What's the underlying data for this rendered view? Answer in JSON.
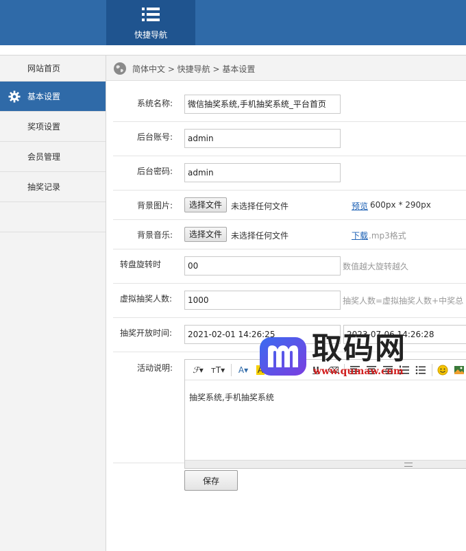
{
  "header": {
    "nav_label": "快捷导航",
    "nav_icon": "list-icon"
  },
  "sidebar": {
    "items": [
      {
        "label": "网站首页"
      },
      {
        "label": "基本设置",
        "icon": "gear-icon",
        "active": true
      },
      {
        "label": "奖项设置"
      },
      {
        "label": "会员管理"
      },
      {
        "label": "抽奖记录"
      }
    ]
  },
  "breadcrumb": {
    "text": "简体中文 > 快捷导航 > 基本设置",
    "icon": "globe-icon"
  },
  "form": {
    "system_name": {
      "label": "系统名称:",
      "value": "微信抽奖系统,手机抽奖系统_平台首页"
    },
    "admin_account": {
      "label": "后台账号:",
      "value": "admin"
    },
    "admin_password": {
      "label": "后台密码:",
      "value": "admin"
    },
    "bg_image": {
      "label": "背景图片:",
      "button": "选择文件",
      "status": "未选择任何文件",
      "link": "预览",
      "extra": "600px * 290px"
    },
    "bg_music": {
      "label": "背景音乐:",
      "button": "选择文件",
      "status": "未选择任何文件",
      "link": "下载",
      "extra": ".mp3格式"
    },
    "spin_speed": {
      "label": "转盘旋转时",
      "value": "00",
      "hint": "数值越大旋转越久"
    },
    "virtual_count": {
      "label": "虚拟抽奖人数:",
      "value": "1000",
      "hint": "抽奖人数=虚拟抽奖人数+中奖总"
    },
    "open_time": {
      "label": "抽奖开放时间:",
      "start": "2021-02-01 14:26:25",
      "end": "2023-07-06 14:26:28"
    },
    "description": {
      "label": "活动说明:",
      "content": "抽奖系统,手机抽奖系统"
    },
    "save_label": "保存"
  },
  "watermark": {
    "text": "取码网",
    "url": "www.qumaw.com"
  },
  "colors": {
    "primary": "#2f6aa8",
    "primary_dark": "#1f548f",
    "link": "#1a5fb4",
    "hint": "#999999"
  }
}
